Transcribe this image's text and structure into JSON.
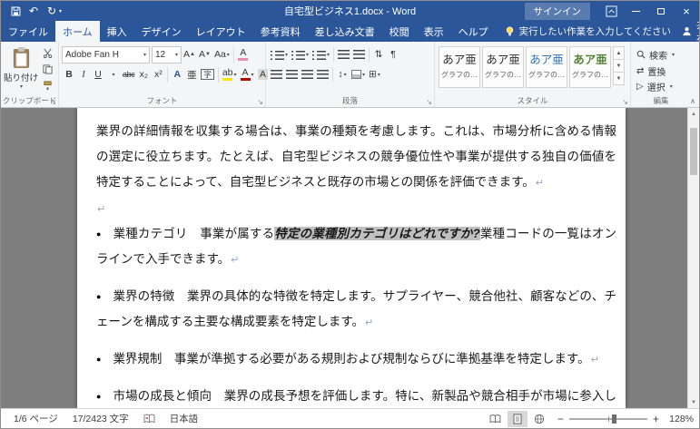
{
  "titlebar": {
    "title": "自宅型ビジネス1.docx - Word",
    "signin": "サインイン"
  },
  "tabs": {
    "file": "ファイル",
    "items": [
      "ホーム",
      "挿入",
      "デザイン",
      "レイアウト",
      "参考資料",
      "差し込み文書",
      "校閲",
      "表示",
      "ヘルプ"
    ],
    "tellme": "実行したい作業を入力してください",
    "share": "共有"
  },
  "ribbon": {
    "clipboard": {
      "label": "クリップボード",
      "paste": "貼り付け"
    },
    "font": {
      "label": "フォント",
      "name": "Adobe Fan H",
      "size": "12",
      "grow": "A",
      "shrink": "A",
      "case": "Aa",
      "clear": "A",
      "bold": "B",
      "italic": "I",
      "underline": "U",
      "strike": "abc",
      "subscript": "x₂",
      "superscript": "x²",
      "effects": "A",
      "ruby": "亜",
      "enclose": "字",
      "highlight": "ab",
      "color": "A",
      "shading": "A"
    },
    "paragraph": {
      "label": "段落"
    },
    "styles": {
      "label": "スタイル",
      "items": [
        {
          "preview": "あア亜",
          "caption": "グラフの…"
        },
        {
          "preview": "あア亜",
          "caption": "グラフの…"
        },
        {
          "preview": "あア亜",
          "caption": "グラフの…"
        },
        {
          "preview": "あア亜",
          "caption": "グラフの…"
        }
      ]
    },
    "editing": {
      "label": "編集",
      "find": "検索",
      "replace": "置換",
      "select": "選択"
    }
  },
  "document": {
    "para1": "業界の詳細情報を収集する場合は、事業の種類を考慮します。これは、市場分析に含める情報の選定に役立ちます。たとえば、自宅型ビジネスの競争優位性や事業が提供する独自の価値を特定することによって、自宅型ビジネスと既存の市場との関係を評価できます。",
    "mark": "↵",
    "bullet_glyph": "●",
    "bullets": [
      {
        "pre": "業種カテゴリ　事業が属する",
        "highlight": "特定の業種別カテゴリはどれですか?",
        "post": "業種コードの一覧はオンラインで入手できます。"
      },
      {
        "pre": "業界の特徴　業界の具体的な特徴を特定します。サプライヤー、競合他社、顧客などの、チェーンを構成する主要な構成要素を特定します。"
      },
      {
        "pre": "業界規制　事業が準拠する必要がある規則および規制ならびに準拠基準を特定します。"
      },
      {
        "pre": "市場の成長と傾向　業界の成長予想を評価します。特に、新製品や競合相手が市場に参入して"
      }
    ]
  },
  "statusbar": {
    "page": "1/6 ページ",
    "chars": "17/2423 文字",
    "language": "日本語",
    "zoom": "128%"
  },
  "icons": {
    "dropdown": "▾",
    "launcher": "↘",
    "collapse": "∧",
    "undo": "↶",
    "redo": "↻",
    "scroll_up": "▲",
    "scroll_down": "▼",
    "pilcrow": "¶",
    "sort": "⇅",
    "spacing": "↕",
    "borders": "⊞",
    "replace": "⇄",
    "select": "▷",
    "close": "×",
    "zoom_out": "−",
    "zoom_in": "+"
  },
  "colors": {
    "titlebar": "#2b579a",
    "accent": "#2b579a",
    "selection": "#c0c0c0"
  }
}
